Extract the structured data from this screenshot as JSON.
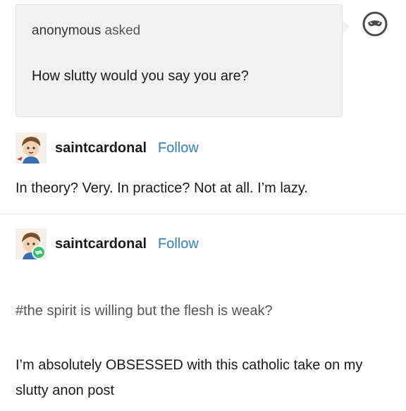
{
  "ask": {
    "asker": "anonymous",
    "verb": "asked",
    "question": "How slutty would you say you are?",
    "avatar_icon": "anonymous-mask-icon"
  },
  "answer": {
    "username": "saintcardonal",
    "follow_label": "Follow",
    "text": "In theory? Very. In practice? Not at all. I’m lazy.",
    "avatar_icon": "user-avatar"
  },
  "reblog": {
    "username": "saintcardonal",
    "follow_label": "Follow",
    "tags": "#the spirit is willing but the flesh is weak?",
    "avatar_icon": "user-avatar-with-reblog-icon"
  },
  "comment": {
    "text": "I’m absolutely OBSESSED with this catholic take on my slutty anon post"
  },
  "colors": {
    "follow": "#2f7fc7",
    "ask_background": "#f2f2f2",
    "reblog_badge": "#3bbf6a"
  }
}
